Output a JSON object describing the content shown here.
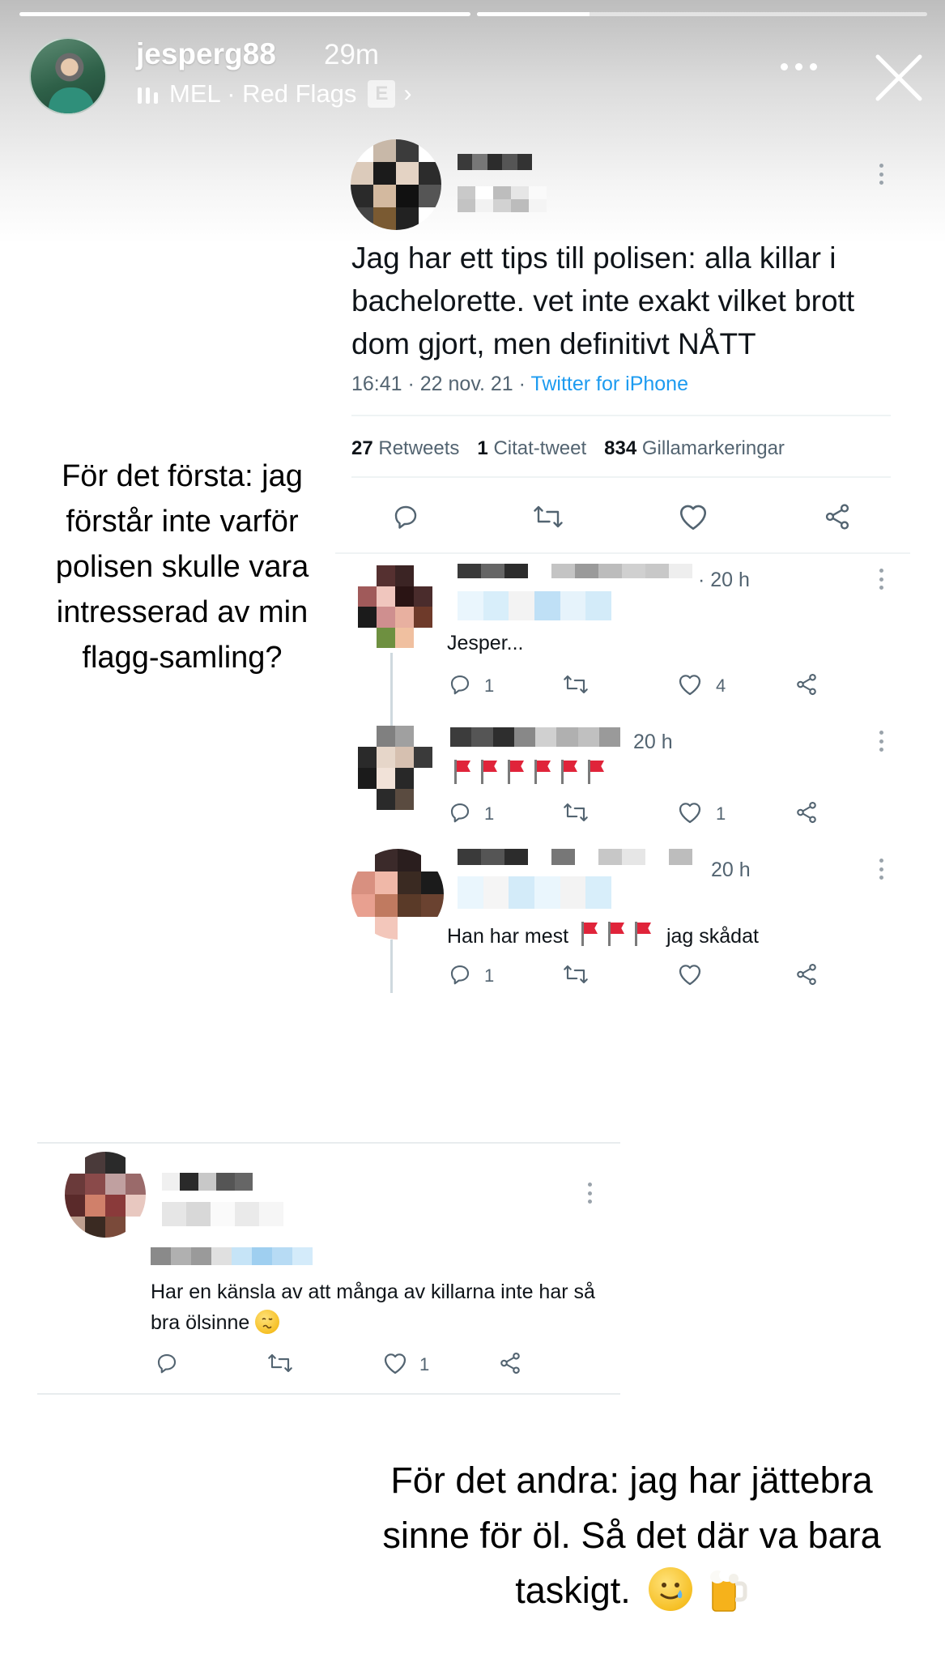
{
  "story": {
    "username": "jesperg88",
    "time": "29m",
    "music_label": "MEL · Red Flags",
    "explicit_badge": "E",
    "progress": [
      1.0,
      0.25
    ]
  },
  "tweet": {
    "text": "Jag har ett tips till polisen: alla killar i bachelorette. vet inte exakt vilket brott dom gjort, men definitivt NÅTT",
    "timestamp": "16:41 · 22 nov. 21 · ",
    "source": "Twitter for iPhone",
    "retweets_count": "27",
    "retweets_label": "Retweets",
    "quotes_count": "1",
    "quotes_label": "Citat-tweet",
    "likes_count": "834",
    "likes_label": "Gillamarkeringar"
  },
  "replies": [
    {
      "time": "· 20 h",
      "text": "Jesper...",
      "reply_count": "1",
      "like_count": "4"
    },
    {
      "time": "20 h",
      "flags": 6,
      "reply_count": "1",
      "like_count": "1"
    },
    {
      "time": "20 h",
      "text_before": "Han har mest",
      "flags": 3,
      "text_after": "jag skådat",
      "reply_count": "1",
      "like_count": ""
    }
  ],
  "card2": {
    "text": "Har en känsla av att många av killarna inte har så bra ölsinne",
    "reply_count": "",
    "like_count": "1"
  },
  "overlays": {
    "first": [
      "För det första: jag",
      "förstår inte varför",
      "polisen skulle vara",
      "intresserad av min",
      "flagg-samling?"
    ],
    "second": [
      "För det andra: jag har jättebra",
      "sinne för öl. Så det där va bara",
      "taskigt."
    ]
  },
  "icons": {
    "reply": "reply-icon",
    "retweet": "retweet-icon",
    "like": "heart-icon",
    "share": "share-icon"
  },
  "colors": {
    "link": "#1d9bf0",
    "flag_red": "#e0243a",
    "muted": "#536471"
  }
}
